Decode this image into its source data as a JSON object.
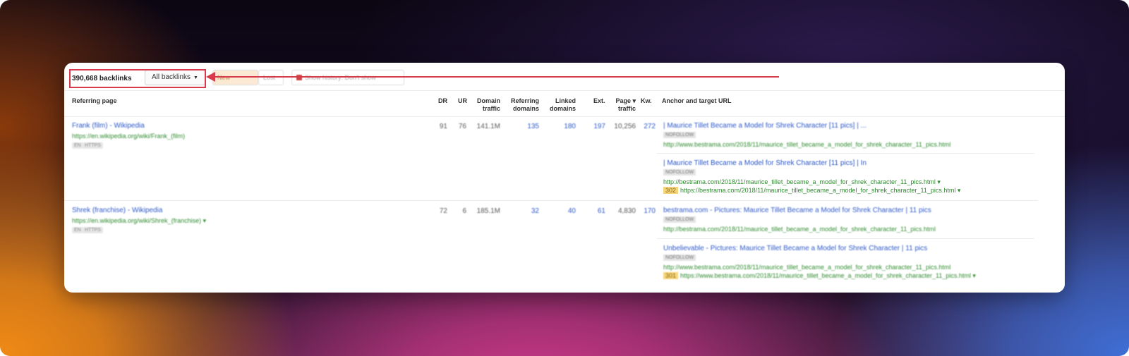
{
  "toolbar": {
    "backlinks_count": "390,668 backlinks",
    "filter_dropdown": "All backlinks",
    "new_button": "New",
    "lost_button": "Lost",
    "history_button": "Show history: Don't show"
  },
  "columns": {
    "referring_page": "Referring page",
    "dr": "DR",
    "ur": "UR",
    "domain_traffic_1": "Domain",
    "domain_traffic_2": "traffic",
    "referring_domains_1": "Referring",
    "referring_domains_2": "domains",
    "linked_domains_1": "Linked",
    "linked_domains_2": "domains",
    "ext": "Ext.",
    "page_traffic_1": "Page ▾",
    "page_traffic_2": "traffic",
    "kw": "Kw.",
    "anchor": "Anchor and target URL"
  },
  "rows": [
    {
      "title": "Frank (film) - Wikipedia",
      "url": "https://en.wikipedia.org/wiki/Frank_(film)",
      "chips": [
        "EN",
        "HTTPS"
      ],
      "dr": "91",
      "ur": "76",
      "domain_traffic": "141.1M",
      "referring_domains": "135",
      "linked_domains": "180",
      "ext": "197",
      "page_traffic": "10,256",
      "kw": "272",
      "anchors": [
        {
          "text": "| Maurice Tillet Became a Model for Shrek Character [11 pics] | ...",
          "tag": "NOFOLLOW",
          "url": "http://www.bestrama.com/2018/11/maurice_tillet_became_a_model_for_shrek_character_11_pics.html"
        },
        {
          "text": "| Maurice Tillet Became a Model for Shrek Character [11 pics] | In",
          "tag": "NOFOLLOW",
          "url": "http://bestrama.com/2018/11/maurice_tillet_became_a_model_for_shrek_character_11_pics.html ▾",
          "redirect_badge": "302",
          "url2": "https://bestrama.com/2018/11/maurice_tillet_became_a_model_for_shrek_character_11_pics.html ▾"
        }
      ]
    },
    {
      "title": "Shrek (franchise) - Wikipedia",
      "url": "https://en.wikipedia.org/wiki/Shrek_(franchise) ▾",
      "chips": [
        "EN",
        "HTTPS"
      ],
      "dr": "72",
      "ur": "6",
      "domain_traffic": "185.1M",
      "referring_domains": "32",
      "linked_domains": "40",
      "ext": "61",
      "page_traffic": "4,830",
      "kw": "170",
      "anchors": [
        {
          "text": "bestrama.com - Pictures: Maurice Tillet Became a Model for Shrek Character | 11 pics",
          "tag": "NOFOLLOW",
          "url": "http://bestrama.com/2018/11/maurice_tillet_became_a_model_for_shrek_character_11_pics.html"
        },
        {
          "text": "Unbelievable - Pictures: Maurice Tillet Became a Model for Shrek Character | 11 pics",
          "tag": "NOFOLLOW",
          "url": "http://www.bestrama.com/2018/11/maurice_tillet_became_a_model_for_shrek_character_11_pics.html",
          "redirect_badge": "301",
          "url2": "https://www.bestrama.com/2018/11/maurice_tillet_became_a_model_for_shrek_character_11_pics.html ▾"
        }
      ]
    }
  ]
}
